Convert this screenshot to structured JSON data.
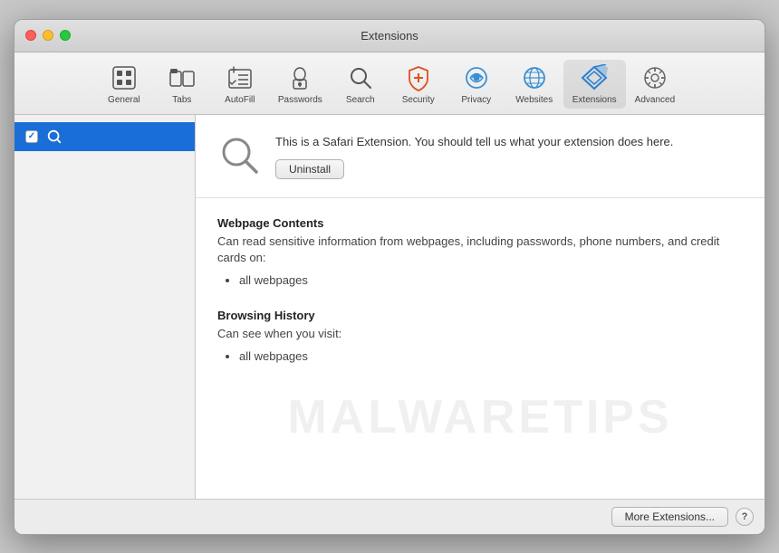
{
  "window": {
    "title": "Extensions"
  },
  "toolbar": {
    "items": [
      {
        "id": "general",
        "label": "General",
        "icon": "general"
      },
      {
        "id": "tabs",
        "label": "Tabs",
        "icon": "tabs"
      },
      {
        "id": "autofill",
        "label": "AutoFill",
        "icon": "autofill"
      },
      {
        "id": "passwords",
        "label": "Passwords",
        "icon": "passwords"
      },
      {
        "id": "search",
        "label": "Search",
        "icon": "search"
      },
      {
        "id": "security",
        "label": "Security",
        "icon": "security"
      },
      {
        "id": "privacy",
        "label": "Privacy",
        "icon": "privacy"
      },
      {
        "id": "websites",
        "label": "Websites",
        "icon": "websites"
      },
      {
        "id": "extensions",
        "label": "Extensions",
        "icon": "extensions",
        "active": true
      },
      {
        "id": "advanced",
        "label": "Advanced",
        "icon": "advanced"
      }
    ]
  },
  "sidebar": {
    "items": [
      {
        "id": "search-ext",
        "label": "Search",
        "enabled": true,
        "selected": true
      }
    ]
  },
  "extension": {
    "description": "This is a Safari Extension. You should tell us what your extension does here.",
    "uninstall_label": "Uninstall"
  },
  "permissions": {
    "sections": [
      {
        "title": "Webpage Contents",
        "description": "Can read sensitive information from webpages, including passwords, phone numbers, and credit cards on:",
        "items": [
          "all webpages"
        ]
      },
      {
        "title": "Browsing History",
        "description": "Can see when you visit:",
        "items": [
          "all webpages"
        ]
      }
    ]
  },
  "footer": {
    "more_extensions_label": "More Extensions...",
    "help_label": "?"
  },
  "watermark": {
    "text": "MALWARETIPS"
  }
}
